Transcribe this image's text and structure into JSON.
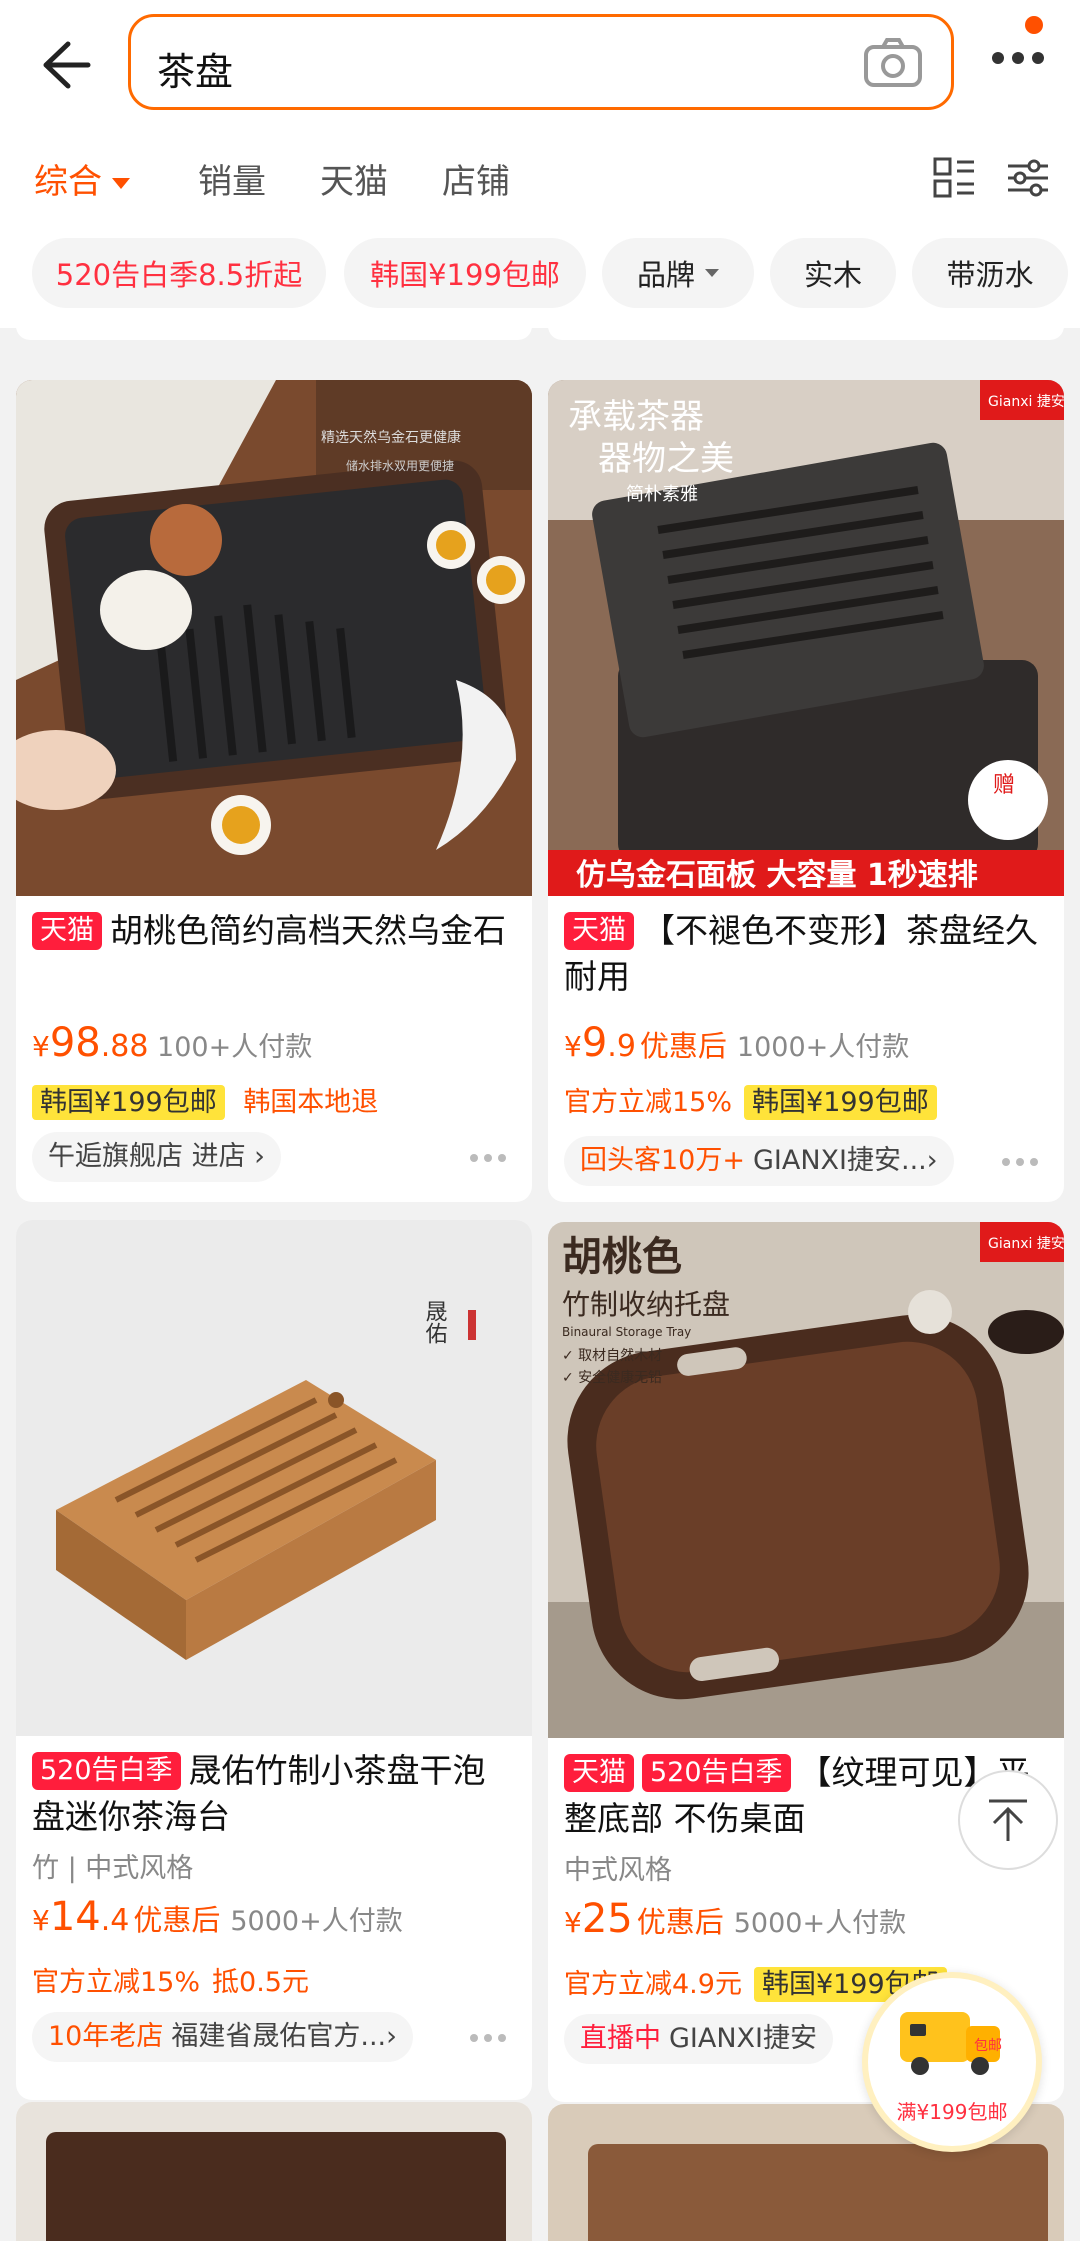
{
  "search": {
    "query": "茶盘"
  },
  "tabs": [
    {
      "label": "综合"
    },
    {
      "label": "销量"
    },
    {
      "label": "天猫"
    },
    {
      "label": "店铺"
    }
  ],
  "chips": [
    {
      "label": "520告白季8.5折起"
    },
    {
      "label": "韩国¥199包邮"
    },
    {
      "label": "品牌"
    },
    {
      "label": "实木"
    },
    {
      "label": "带沥水"
    }
  ],
  "products": [
    {
      "badges": [
        "天猫"
      ],
      "title": "胡桃色简约高档天然乌金石",
      "price_main": "98",
      "price_dec": ".88",
      "after_label": "",
      "sales": "100+人付款",
      "tag_orange": "",
      "tag_yellow": "韩国¥199包邮",
      "tag_extra": "韩国本地退",
      "shop_prefix": "",
      "shop": "午逅旗舰店 进店 ›",
      "image_text": [
        "精选天然乌金石更健康",
        "储水排水双用更便捷"
      ]
    },
    {
      "badges": [
        "天猫"
      ],
      "title": "【不褪色不变形】茶盘经久耐用",
      "price_main": "9",
      "price_dec": ".9",
      "after_label": "优惠后",
      "sales": "1000+人付款",
      "tag_orange": "官方立减15%",
      "tag_yellow": "韩国¥199包邮",
      "tag_extra": "",
      "shop_prefix": "回头客10万+",
      "shop": "GIANXI捷安...›",
      "image_text": [
        "承载茶器",
        "器物之美",
        "简朴素雅",
        "仿乌金石面板 大容量 1秒速排",
        "Gianxi 捷安玺",
        "赠"
      ]
    },
    {
      "badges": [
        "520告白季"
      ],
      "title": "晟佑竹制小茶盘干泡盘迷你茶海台",
      "attrs": "竹 | 中式风格",
      "price_main": "14",
      "price_dec": ".4",
      "after_label": "优惠后",
      "sales": "5000+人付款",
      "tag_orange": "官方立减15%",
      "tag_orange2": "抵0.5元",
      "shop_prefix": "10年老店",
      "shop": "福建省晟佑官方...›",
      "image_text": [
        "晟佑"
      ]
    },
    {
      "badges": [
        "天猫",
        "520告白季"
      ],
      "title": "【纹理可见】平整底部 不伤桌面",
      "attrs": "中式风格",
      "price_main": "25",
      "price_dec": "",
      "after_label": "优惠后",
      "sales": "5000+人付款",
      "tag_orange": "官方立减4.9元",
      "tag_yellow": "韩国¥199包邮",
      "shop_prefix": "直播中",
      "shop": "GIANXI捷安",
      "image_text": [
        "胡桃色",
        "竹制收纳托盘",
        "Binaural Storage Tray",
        "✓ 取材自然木材",
        "✓ 安全健康无铅",
        "Gianxi 捷安玺"
      ]
    }
  ],
  "float_promo": {
    "label": "满¥199包邮",
    "badge": "包邮"
  }
}
